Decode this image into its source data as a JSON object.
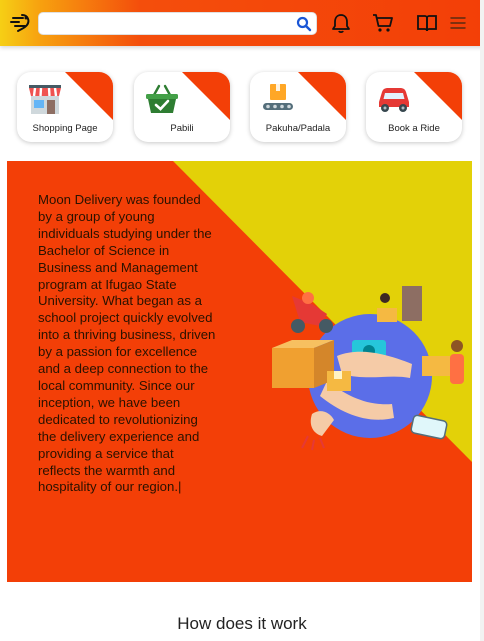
{
  "header": {
    "search_placeholder": "",
    "icons": [
      "logo-icon",
      "search-icon",
      "bell-icon",
      "cart-icon",
      "book-icon",
      "menu-icon"
    ]
  },
  "services": [
    {
      "label": "Shopping Page",
      "icon": "store-icon"
    },
    {
      "label": "Pabili",
      "icon": "basket-icon"
    },
    {
      "label": "Pakuha/Padala",
      "icon": "conveyor-box-icon"
    },
    {
      "label": "Book a Ride",
      "icon": "car-icon"
    }
  ],
  "about": {
    "text": "Moon Delivery was founded by a group of young individuals studying under the Bachelor of Science in Business and Management program at Ifugao State University. What began as a school project quickly evolved into a thriving business, driven by a passion for excellence and a deep connection to the local community. Since our inception, we have been dedicated to revolutionizing the delivery experience and providing a service that reflects the warmth and hospitality of our region.|"
  },
  "section": {
    "how_title": "How does it work"
  },
  "colors": {
    "brand_orange": "#f33f07",
    "brand_yellow": "#e3d108",
    "text_dark": "#2a1200"
  }
}
